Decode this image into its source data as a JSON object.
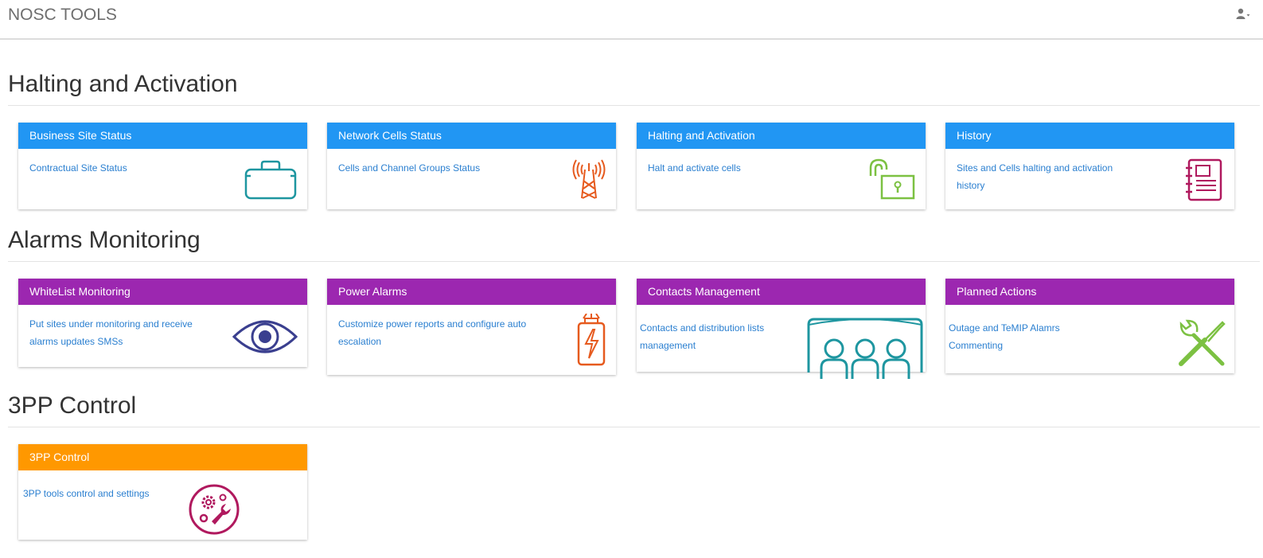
{
  "navbar": {
    "brand": "NOSC TOOLS",
    "user_icon": "user-icon"
  },
  "colors": {
    "blue": "#2196f3",
    "purple": "#9c27b0",
    "orange": "#ff9800",
    "link": "#2a7fd0"
  },
  "sections": [
    {
      "title": "Halting and Activation",
      "cards": [
        {
          "title": "Business Site Status",
          "text": "Contractual Site Status",
          "icon": "briefcase-icon"
        },
        {
          "title": "Network Cells Status",
          "text": "Cells and Channel Groups Status",
          "icon": "antenna-tower-icon"
        },
        {
          "title": "Halting and Activation",
          "text": "Halt and activate cells",
          "icon": "unlocked-padlock-icon"
        },
        {
          "title": "History",
          "text": "Sites and Cells halting and activation history",
          "icon": "notebook-icon"
        }
      ]
    },
    {
      "title": "Alarms Monitoring",
      "cards": [
        {
          "title": "WhiteList Monitoring",
          "text": "Put sites under monitoring and receive alarms updates SMSs",
          "icon": "eye-icon"
        },
        {
          "title": "Power Alarms",
          "text": "Customize power reports and configure auto escalation",
          "icon": "power-battery-icon"
        },
        {
          "title": "Contacts Management",
          "text": "Contacts and distribution lists management",
          "icon": "people-group-icon"
        },
        {
          "title": "Planned Actions",
          "text": "Outage and TeMIP Alamrs Commenting",
          "icon": "screwdriver-wrench-icon"
        }
      ]
    },
    {
      "title": "3PP Control",
      "cards": [
        {
          "title": "3PP Control",
          "text": "3PP tools control and settings",
          "icon": "gears-wrench-icon"
        }
      ]
    }
  ]
}
